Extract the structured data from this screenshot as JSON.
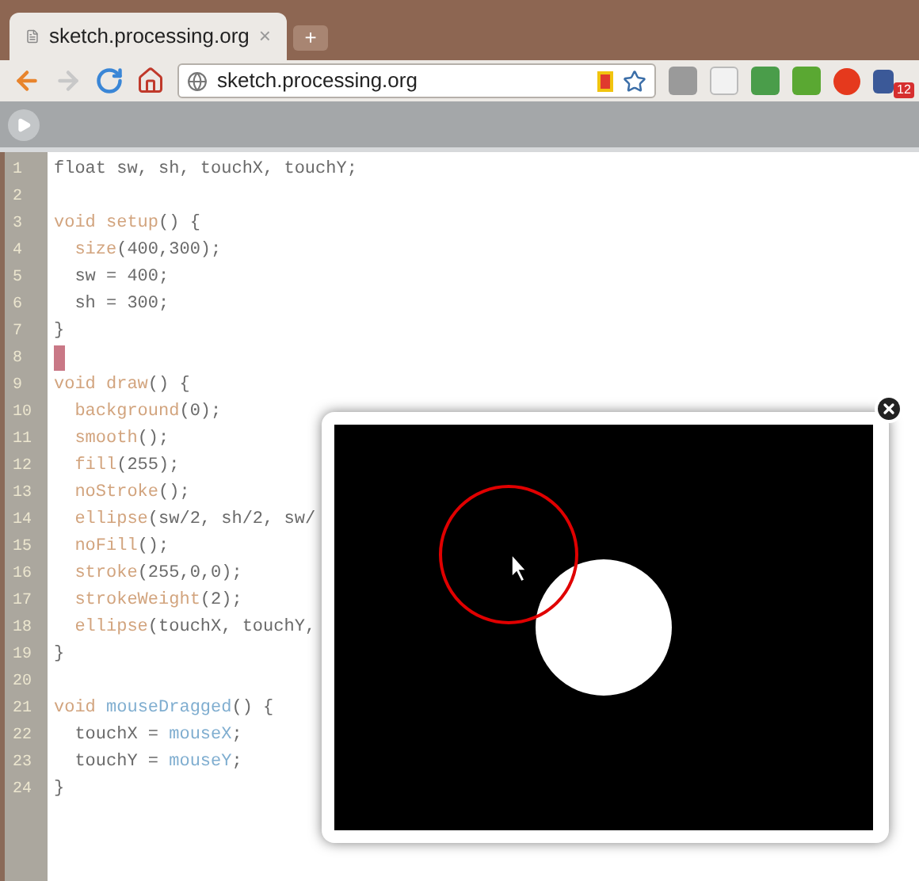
{
  "browser": {
    "tab": {
      "title": "sketch.processing.org",
      "close": "×"
    },
    "new_tab": "+",
    "address": "sketch.processing.org",
    "notification_badge": "12"
  },
  "editor": {
    "lines": [
      {
        "number": "1",
        "cursor": false,
        "segments": [
          {
            "kind": "plain",
            "text": "float sw, sh, touchX, touchY;"
          }
        ]
      },
      {
        "number": "2",
        "cursor": false
      },
      {
        "number": "3",
        "cursor": false,
        "segments": [
          {
            "kind": "keyword",
            "text": "void setup"
          },
          {
            "kind": "plain",
            "text": "() {"
          }
        ]
      },
      {
        "number": "4",
        "cursor": false,
        "segments": [
          {
            "kind": "keyword",
            "text": "  size"
          },
          {
            "kind": "plain",
            "text": "(400,300);"
          }
        ]
      },
      {
        "number": "5",
        "cursor": false,
        "segments": [
          {
            "kind": "plain",
            "text": "  sw = 400;"
          }
        ]
      },
      {
        "number": "6",
        "cursor": false,
        "segments": [
          {
            "kind": "plain",
            "text": "  sh = 300;"
          }
        ]
      },
      {
        "number": "7",
        "cursor": false,
        "segments": [
          {
            "kind": "plain",
            "text": "}"
          }
        ]
      },
      {
        "number": "8",
        "cursor": true
      },
      {
        "number": "9",
        "cursor": false,
        "segments": [
          {
            "kind": "keyword",
            "text": "void draw"
          },
          {
            "kind": "plain",
            "text": "() {"
          }
        ]
      },
      {
        "number": "10",
        "cursor": false,
        "segments": [
          {
            "kind": "keyword",
            "text": "  background"
          },
          {
            "kind": "plain",
            "text": "(0);"
          }
        ]
      },
      {
        "number": "11",
        "cursor": false,
        "segments": [
          {
            "kind": "keyword",
            "text": "  smooth"
          },
          {
            "kind": "plain",
            "text": "();"
          }
        ]
      },
      {
        "number": "12",
        "cursor": false,
        "segments": [
          {
            "kind": "keyword",
            "text": "  fill"
          },
          {
            "kind": "plain",
            "text": "(255);"
          }
        ]
      },
      {
        "number": "13",
        "cursor": false,
        "segments": [
          {
            "kind": "keyword",
            "text": "  noStroke"
          },
          {
            "kind": "plain",
            "text": "();"
          }
        ]
      },
      {
        "number": "14",
        "cursor": false,
        "segments": [
          {
            "kind": "keyword",
            "text": "  ellipse"
          },
          {
            "kind": "plain",
            "text": "(sw/2, sh/2, sw/"
          }
        ]
      },
      {
        "number": "15",
        "cursor": false,
        "segments": [
          {
            "kind": "keyword",
            "text": "  noFill"
          },
          {
            "kind": "plain",
            "text": "();"
          }
        ]
      },
      {
        "number": "16",
        "cursor": false,
        "segments": [
          {
            "kind": "keyword",
            "text": "  stroke"
          },
          {
            "kind": "plain",
            "text": "(255,0,0);"
          }
        ]
      },
      {
        "number": "17",
        "cursor": false,
        "segments": [
          {
            "kind": "keyword",
            "text": "  strokeWeight"
          },
          {
            "kind": "plain",
            "text": "(2);"
          }
        ]
      },
      {
        "number": "18",
        "cursor": false,
        "segments": [
          {
            "kind": "keyword",
            "text": "  ellipse"
          },
          {
            "kind": "plain",
            "text": "(touchX, touchY,"
          }
        ]
      },
      {
        "number": "19",
        "cursor": false,
        "segments": [
          {
            "kind": "plain",
            "text": "}"
          }
        ]
      },
      {
        "number": "20",
        "cursor": false
      },
      {
        "number": "21",
        "cursor": false,
        "segments": [
          {
            "kind": "keyword",
            "text": "void "
          },
          {
            "kind": "builtin",
            "text": "mouseDragged"
          },
          {
            "kind": "plain",
            "text": "() {"
          }
        ]
      },
      {
        "number": "22",
        "cursor": false,
        "segments": [
          {
            "kind": "plain",
            "text": "  touchX = "
          },
          {
            "kind": "builtin",
            "text": "mouseX"
          },
          {
            "kind": "plain",
            "text": ";"
          }
        ]
      },
      {
        "number": "23",
        "cursor": false,
        "segments": [
          {
            "kind": "plain",
            "text": "  touchY = "
          },
          {
            "kind": "builtin",
            "text": "mouseY"
          },
          {
            "kind": "plain",
            "text": ";"
          }
        ]
      },
      {
        "number": "24",
        "cursor": false,
        "segments": [
          {
            "kind": "plain",
            "text": "}"
          }
        ]
      }
    ]
  }
}
